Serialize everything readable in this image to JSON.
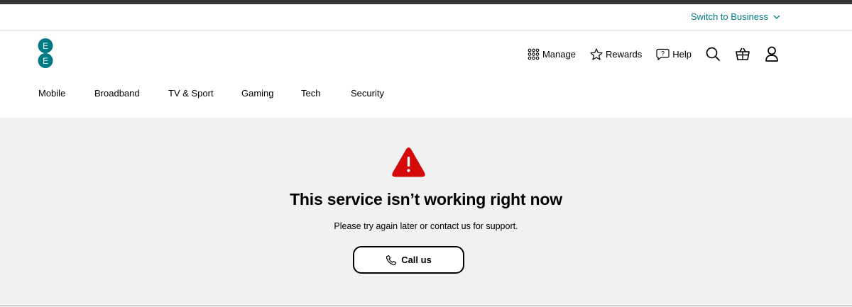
{
  "utility": {
    "switch_label": "Switch to Business"
  },
  "header": {
    "actions": [
      {
        "label": "Manage",
        "icon": "grid-icon"
      },
      {
        "label": "Rewards",
        "icon": "star-icon"
      },
      {
        "label": "Help",
        "icon": "help-icon"
      }
    ],
    "icon_buttons": [
      "search-icon",
      "basket-icon",
      "account-icon"
    ]
  },
  "nav": {
    "items": [
      "Mobile",
      "Broadband",
      "TV & Sport",
      "Gaming",
      "Tech",
      "Security"
    ]
  },
  "error": {
    "title": "This service isn’t working right now",
    "message": "Please try again later or contact us for support.",
    "button_label": "Call us"
  },
  "colors": {
    "brand_teal": "#007b85",
    "warning_red": "#d50a0a",
    "page_bg": "#f1f1f1"
  }
}
